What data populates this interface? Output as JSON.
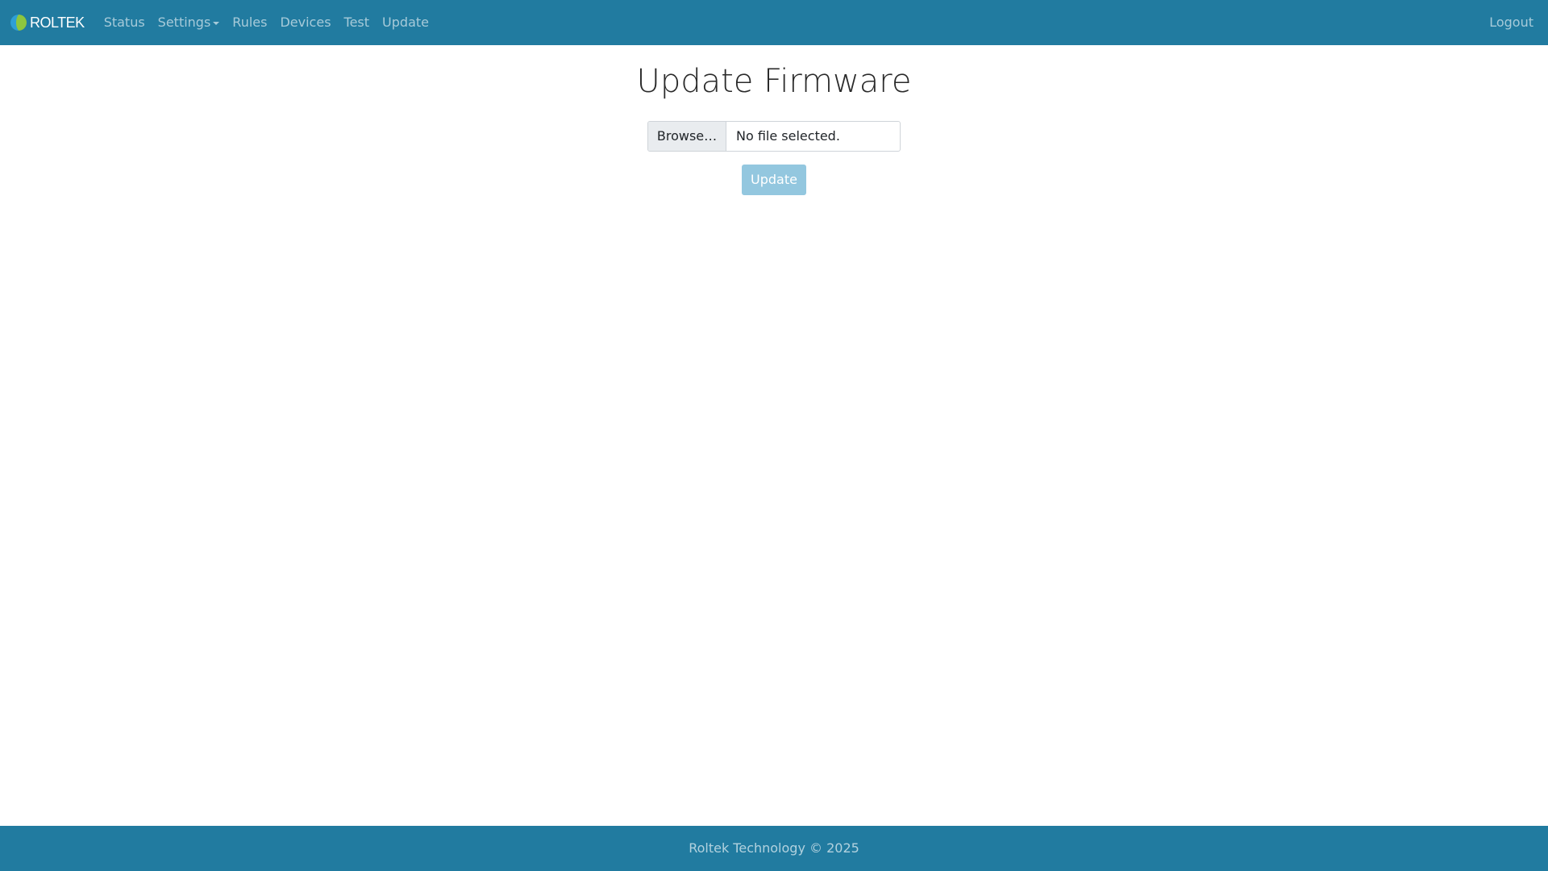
{
  "navbar": {
    "brand": "ROLTEK",
    "links": [
      "Status",
      "Settings",
      "Rules",
      "Devices",
      "Test",
      "Update"
    ],
    "logout": "Logout",
    "bg_color": "#217ba0"
  },
  "main": {
    "title": "Update Firmware",
    "file_input": {
      "browse_label": "Browse…",
      "status": "No file selected."
    },
    "update_button": "Update"
  },
  "footer": {
    "text": "Roltek Technology © 2025"
  }
}
